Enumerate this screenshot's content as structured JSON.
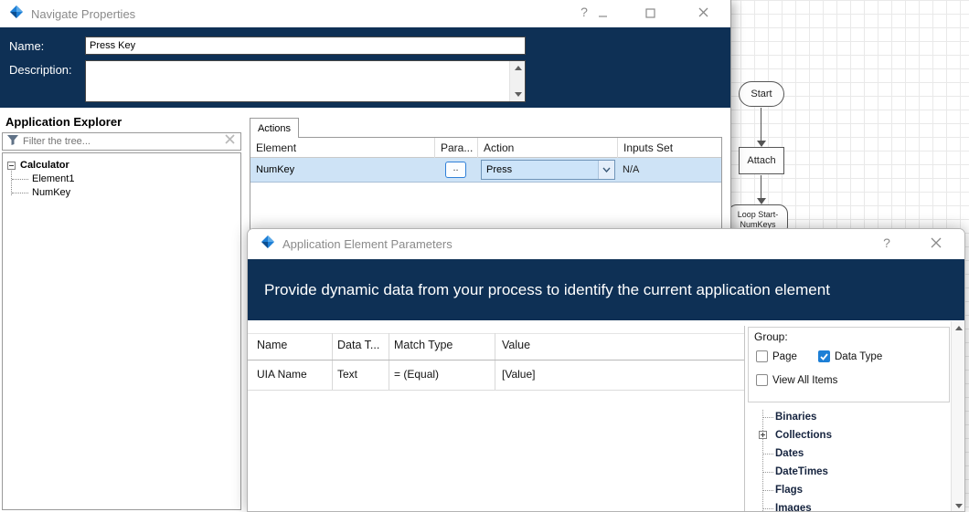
{
  "theme": {
    "navy": "#0e3055",
    "row_highlight": "#cee3f6",
    "accent_blue": "#1d7fd6"
  },
  "navigate_properties": {
    "title": "Navigate Properties",
    "help_glyph": "?",
    "name_label": "Name:",
    "name_value": "Press Key",
    "description_label": "Description:",
    "description_value": "",
    "explorer_heading": "Application Explorer",
    "filter_placeholder": "Filter the tree...",
    "tree": {
      "root": "Calculator",
      "children": [
        "Element1",
        "NumKey"
      ]
    },
    "actions_tab_label": "Actions",
    "table": {
      "headers": [
        "Element",
        "Para...",
        "Action",
        "Inputs Set"
      ],
      "row": {
        "element": "NumKey",
        "params_button": "..",
        "action": "Press",
        "inputs_set": "N/A"
      }
    }
  },
  "element_parameters": {
    "title": "Application Element Parameters",
    "help_glyph": "?",
    "banner": "Provide dynamic data from your process to identify the current application element",
    "table": {
      "headers": [
        "Name",
        "Data T...",
        "Match Type",
        "Value"
      ],
      "row": {
        "name": "UIA Name",
        "data_type": "Text",
        "match_type": "=  (Equal)",
        "value": "[Value]"
      }
    },
    "group_panel": {
      "label": "Group:",
      "checkbox_page": "Page",
      "checkbox_data_type": "Data Type",
      "checkbox_view_all": "View All Items",
      "tree_items": [
        "Binaries",
        "Collections",
        "Dates",
        "DateTimes",
        "Flags",
        "Images"
      ]
    }
  },
  "flowchart": {
    "start": "Start",
    "attach": "Attach",
    "loop_line1": "Loop Start-",
    "loop_line2": "NumKeys"
  }
}
